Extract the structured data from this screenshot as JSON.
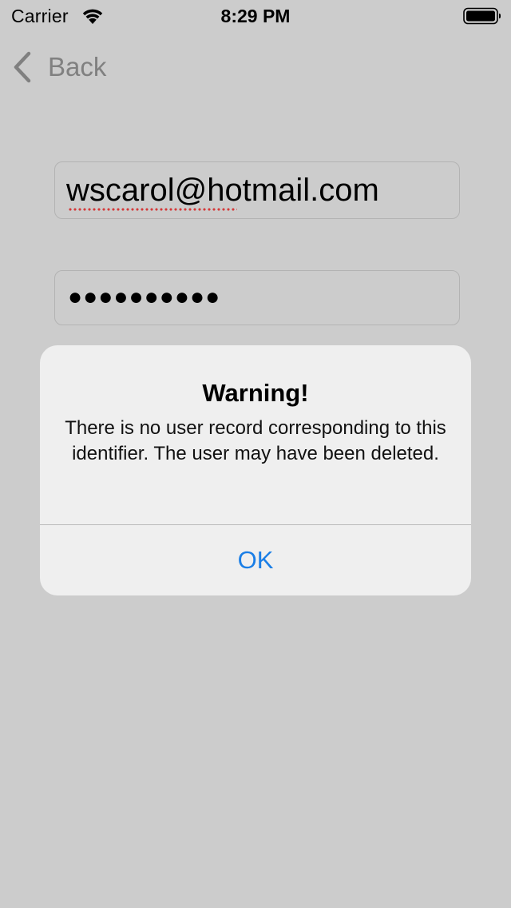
{
  "status_bar": {
    "carrier": "Carrier",
    "time": "8:29 PM",
    "icons": [
      "wifi-icon",
      "battery-icon"
    ]
  },
  "nav": {
    "back_label": "Back",
    "back_icon": "chevron-left-icon"
  },
  "form": {
    "email_value": "wscarol@hotmail.com",
    "password_masked": "●●●●●●●●●●"
  },
  "alert": {
    "title": "Warning!",
    "message": "There is no user record corresponding to this identifier. The user may have been deleted.",
    "ok_label": "OK"
  },
  "colors": {
    "background": "#cccccc",
    "alert_background": "#efefef",
    "accent": "#1a7ee6",
    "back_gray": "#808080",
    "spellcheck_red": "#d43a3a"
  }
}
